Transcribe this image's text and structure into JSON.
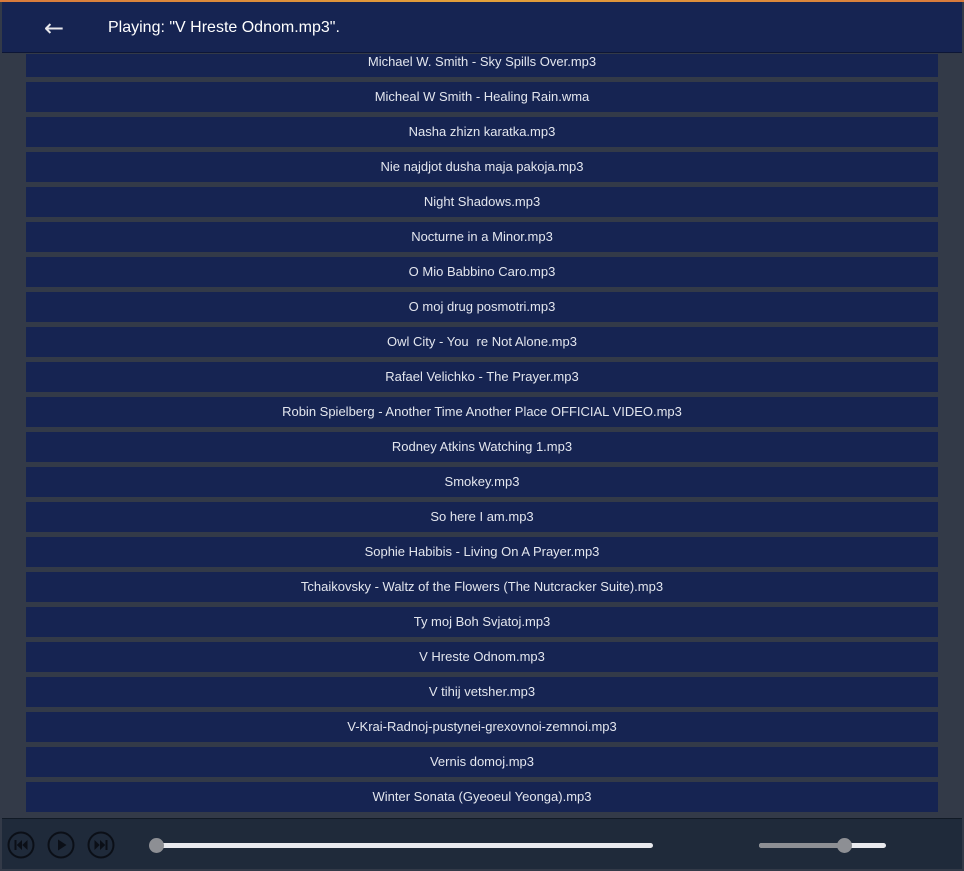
{
  "header": {
    "back_icon": "←",
    "now_playing": "Playing: \"V Hreste Odnom.mp3\"."
  },
  "tracks": [
    "Michael W. Smith - Sky Spills Over.mp3",
    "Micheal W Smith - Healing Rain.wma",
    "Nasha zhizn karatka.mp3",
    "Nie najdjot dusha maja pakoja.mp3",
    "Night Shadows.mp3",
    "Nocturne in a Minor.mp3",
    "O Mio Babbino Caro.mp3",
    "O moj drug posmotri.mp3",
    "Owl City - Youre Not Alone.mp3",
    "Rafael Velichko - The Prayer.mp3",
    "Robin Spielberg - Another Time Another Place OFFICIAL VIDEO.mp3",
    "Rodney Atkins Watching 1.mp3",
    "Smokey.mp3",
    "So here I am.mp3",
    "Sophie Habibis - Living On A Prayer.mp3",
    "Tchaikovsky - Waltz of the Flowers (The Nutcracker Suite).mp3",
    "Ty moj Boh Svjatoj.mp3",
    "V Hreste Odnom.mp3",
    "V tihij vetsher.mp3",
    "V-Krai-Radnoj-pustynei-grexovnoi-zemnoi.mp3",
    "Vernis domoj.mp3",
    "Winter Sonata (Gyeoeul Yeonga).mp3"
  ],
  "controls": {
    "icons": [
      "skip-previous-icon",
      "play-icon",
      "skip-next-icon"
    ],
    "seek_progress": 0.0,
    "volume_level": 0.67
  },
  "colors": {
    "header_bg": "#162452",
    "item_bg": "#162452",
    "page_bg": "#333a48",
    "controls_bg": "#1f2a3a",
    "accent_bar": "#e2a03a"
  }
}
